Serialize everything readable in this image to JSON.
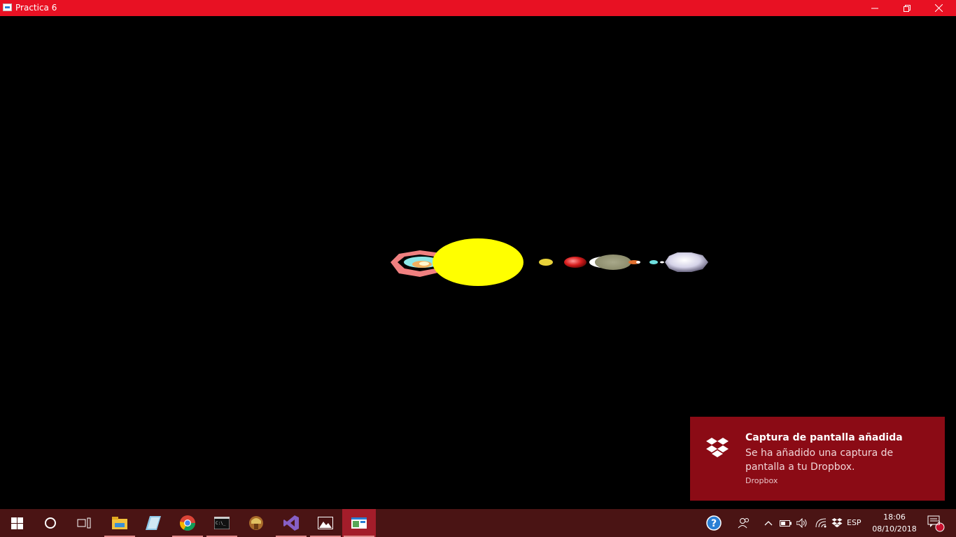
{
  "window": {
    "title": "Practica 6"
  },
  "toast": {
    "title": "Captura de pantalla añadida",
    "body": "Se ha añadido una captura de pantalla a tu Dropbox.",
    "source": "Dropbox"
  },
  "taskbar": {
    "apps": [
      "start-icon",
      "cortana-icon",
      "task-view-icon",
      "file-explorer-icon",
      "notepad-icon",
      "chrome-icon",
      "terminal-icon",
      "game-icon",
      "visual-studio-icon",
      "photos-icon",
      "opengl-app-icon"
    ]
  },
  "tray": {
    "language": "ESP",
    "time": "18:06",
    "date": "08/10/2018",
    "notification_count": "3"
  },
  "colors": {
    "titlebar": "#e81123",
    "toast_bg": "#8b0b15",
    "taskbar_bg": "#4a1414",
    "sun": "#ffff00"
  }
}
